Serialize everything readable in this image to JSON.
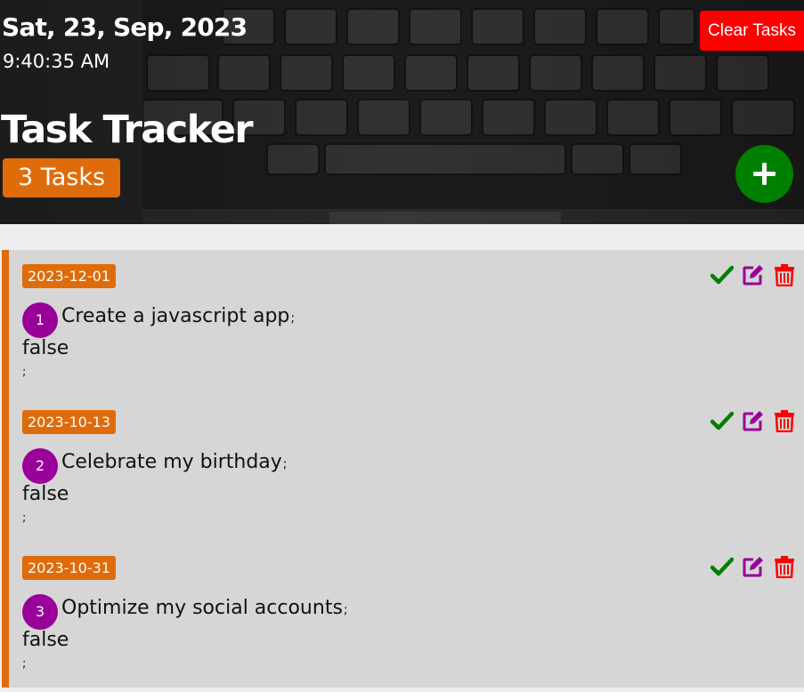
{
  "header": {
    "date": "Sat, 23, Sep, 2023",
    "time": "9:40:35 AM",
    "title": "Task Tracker",
    "task_count": "3 Tasks",
    "clear_label": "Clear Tasks",
    "add_icon": "plus-icon",
    "background": "laptop-keyboard-photo"
  },
  "colors": {
    "accent": "#e06b0a",
    "clear": "#ff0000",
    "add": "#008000",
    "number": "#990099",
    "done_icon": "#008000",
    "edit_icon": "#990099",
    "delete_icon": "#ff0000",
    "list_bg": "#d6d6d6"
  },
  "tasks": [
    {
      "due": "2023-12-01",
      "number": "1",
      "text": "Create a javascript app",
      "sep": ";",
      "status": "false",
      "trail": ";",
      "icons": [
        "check-icon",
        "edit-icon",
        "trash-icon"
      ]
    },
    {
      "due": "2023-10-13",
      "number": "2",
      "text": "Celebrate my birthday",
      "sep": ";",
      "status": "false",
      "trail": ";",
      "icons": [
        "check-icon",
        "edit-icon",
        "trash-icon"
      ]
    },
    {
      "due": "2023-10-31",
      "number": "3",
      "text": "Optimize my social accounts",
      "sep": ";",
      "status": "false",
      "trail": ";",
      "icons": [
        "check-icon",
        "edit-icon",
        "trash-icon"
      ]
    }
  ]
}
